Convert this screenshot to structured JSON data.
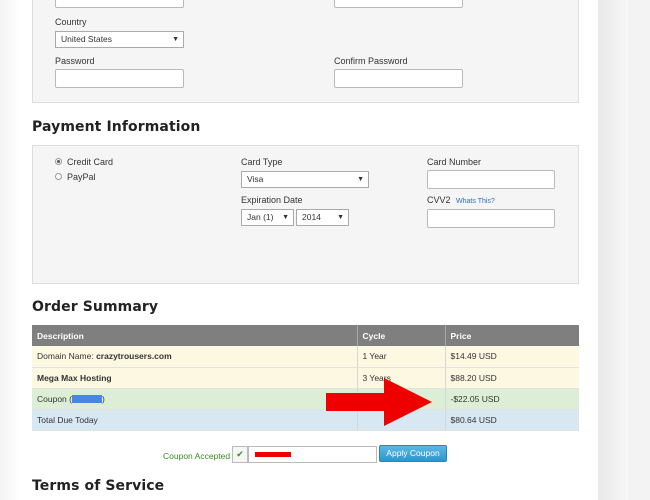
{
  "account": {
    "country_label": "Country",
    "country_value": "United States",
    "password_label": "Password",
    "confirm_password_label": "Confirm Password"
  },
  "payment": {
    "heading": "Payment Information",
    "methods": [
      {
        "label": "Credit Card",
        "selected": true
      },
      {
        "label": "PayPal",
        "selected": false
      }
    ],
    "card_type_label": "Card Type",
    "card_type_value": "Visa",
    "card_number_label": "Card Number",
    "expiration_label": "Expiration Date",
    "exp_month_value": "Jan (1)",
    "exp_year_value": "2014",
    "cvv_label": "CVV2",
    "cvv_help_link": "Whats This?"
  },
  "order_summary": {
    "heading": "Order Summary",
    "columns": [
      "Description",
      "Cycle",
      "Price"
    ],
    "rows": [
      {
        "label": "Domain Name: ",
        "value": "crazytrousers.com",
        "cycle": "1 Year",
        "price": "$14.49 USD"
      },
      {
        "label": "Mega Max Hosting",
        "cycle": "3 Years",
        "price": "$88.20 USD"
      },
      {
        "label": "Coupon (",
        "label_end": ")",
        "cycle": "",
        "price": "-$22.05 USD"
      },
      {
        "label": "Total Due Today",
        "cycle": "",
        "price": "$80.64 USD"
      }
    ]
  },
  "coupon": {
    "status_label": "Coupon Accepted",
    "apply_button": "Apply Coupon"
  },
  "terms": {
    "heading": "Terms of Service"
  },
  "colors": {
    "table_header": "#7f7f7f",
    "row_cream": "#fdf8e2",
    "row_green": "#dcefd6",
    "row_blue": "#d7e8f3",
    "button_blue": "#3da3d6",
    "annotation_arrow": "#ee0000",
    "coupon_green": "#3c8a24"
  },
  "icons": {
    "check": "check-icon",
    "dropdown": "chevron-down-icon",
    "arrow": "annotation-arrow-icon"
  }
}
